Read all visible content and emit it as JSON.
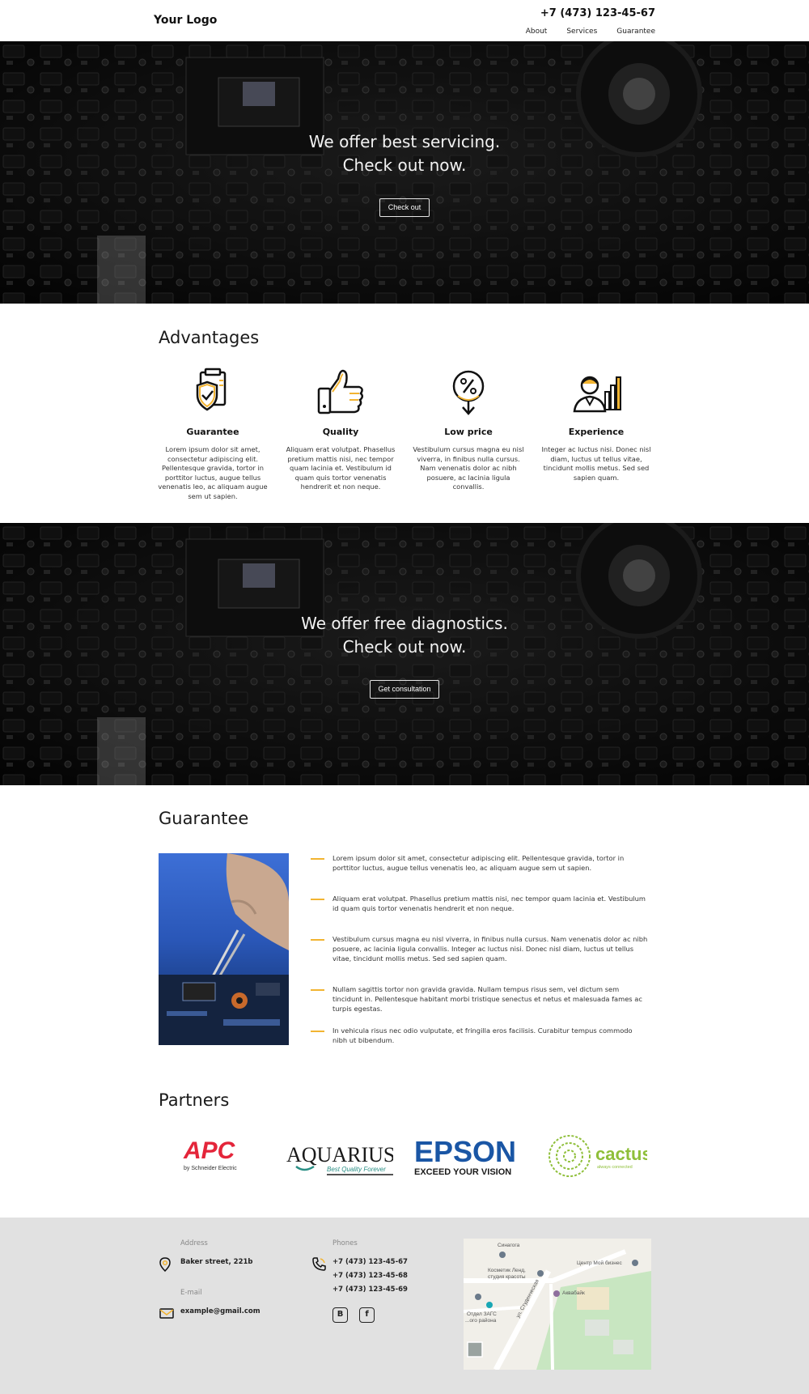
{
  "header": {
    "logo": "Your Logo",
    "phone": "+7 (473) 123-45-67",
    "nav": [
      "About",
      "Services",
      "Guarantee"
    ]
  },
  "hero1": {
    "line1": "We offer best servicing.",
    "line2": "Check out now.",
    "button": "Check out"
  },
  "advantages": {
    "title": "Advantages",
    "items": [
      {
        "title": "Guarantee",
        "icon": "shield-document-icon",
        "text": "Lorem ipsum dolor sit amet, consectetur adipiscing elit. Pellentesque gravida, tortor in porttitor luctus, augue tellus venenatis leo, ac aliquam augue sem ut sapien."
      },
      {
        "title": "Quality",
        "icon": "thumbs-up-icon",
        "text": "Aliquam erat volutpat. Phasellus pretium mattis nisi, nec tempor quam lacinia et. Vestibulum id quam quis tortor venenatis hendrerit et non neque."
      },
      {
        "title": "Low price",
        "icon": "percent-tag-icon",
        "text": "Vestibulum cursus magna eu nisl viverra, in finibus nulla cursus. Nam venenatis dolor ac nibh posuere, ac lacinia ligula convallis."
      },
      {
        "title": "Experience",
        "icon": "person-chart-icon",
        "text": "Integer ac luctus nisi. Donec nisl diam, luctus ut tellus vitae, tincidunt mollis metus. Sed sed sapien quam."
      }
    ]
  },
  "hero2": {
    "line1": "We offer free diagnostics.",
    "line2": "Check out now.",
    "button": "Get consultation"
  },
  "guarantee": {
    "title": "Guarantee",
    "items": [
      "Lorem ipsum dolor sit amet, consectetur adipiscing elit. Pellentesque gravida, tortor in porttitor luctus, augue tellus venenatis leo, ac aliquam augue sem ut sapien.",
      "Aliquam erat volutpat. Phasellus pretium mattis nisi, nec tempor quam lacinia et. Vestibulum id quam quis tortor venenatis hendrerit et non neque.",
      "Vestibulum cursus magna eu nisl viverra, in finibus nulla cursus. Nam venenatis dolor ac nibh posuere, ac lacinia ligula convallis. Integer ac luctus nisi. Donec nisl diam, luctus ut tellus vitae, tincidunt mollis metus. Sed sed sapien quam.",
      "Nullam sagittis tortor non gravida gravida. Nullam tempus risus sem, vel dictum sem tincidunt in. Pellentesque habitant morbi tristique senectus et netus et malesuada fames ac turpis egestas.",
      "In vehicula risus nec odio vulputate, et fringilla eros facilisis. Curabitur tempus commodo nibh ut bibendum."
    ]
  },
  "partners": {
    "title": "Partners",
    "logos": [
      {
        "name": "APC",
        "sub": "by Schneider Electric"
      },
      {
        "name": "AQUARIUS",
        "sub": "Best Quality Forever"
      },
      {
        "name": "EPSON",
        "sub": "EXCEED YOUR VISION"
      },
      {
        "name": "cactus",
        "sub": "always connected"
      }
    ]
  },
  "footer": {
    "address_label": "Address",
    "address": "Baker street, 221b",
    "email_label": "E-mail",
    "email": "example@gmail.com",
    "phones_label": "Phones",
    "phones": [
      "+7 (473) 123-45-67",
      "+7 (473) 123-45-68",
      "+7 (473) 123-45-69"
    ],
    "social": [
      "B",
      "f"
    ]
  },
  "map": {
    "labels": [
      "Синагога",
      "Центр Мой бизнес",
      "Косметик Ленд,",
      "студия красоты",
      "Аквабайк",
      "Отдел ЗАГС",
      "...ого района",
      "ул. Студенческая"
    ]
  },
  "colors": {
    "accent": "#f2b431",
    "footer_bg": "#e1e1e1",
    "apc_red": "#e4253a",
    "epson_blue": "#1a56a5",
    "cactus_green": "#8fbf3a",
    "aquarius_teal": "#2a8f85"
  }
}
